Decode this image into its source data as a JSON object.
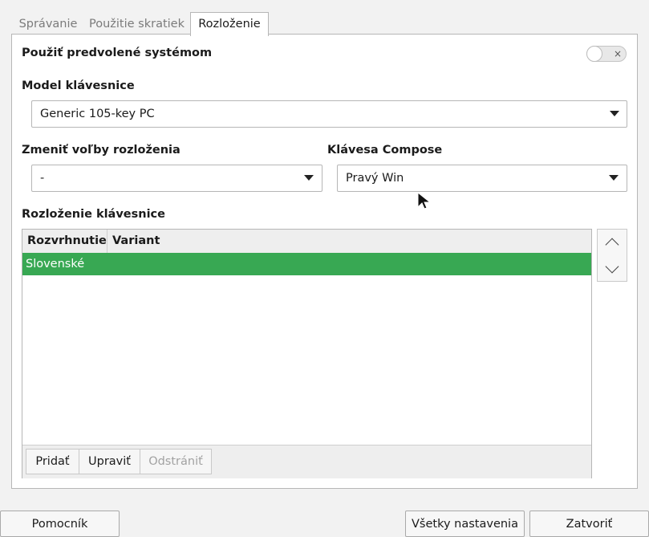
{
  "tabs": [
    {
      "label": "Správanie"
    },
    {
      "label": "Použitie skratiek"
    },
    {
      "label": "Rozloženie"
    }
  ],
  "use_system_default": {
    "label": "Použiť predvolené systémom",
    "toggle_on": false,
    "toggle_mark": "×"
  },
  "keyboard_model": {
    "label": "Model klávesnice",
    "value": "Generic 105-key PC"
  },
  "layout_options": {
    "label": "Zmeniť voľby rozloženia",
    "value": "-"
  },
  "compose_key": {
    "label": "Klávesa Compose",
    "value": "Pravý Win"
  },
  "layouts": {
    "label": "Rozloženie klávesnice",
    "columns": [
      "Rozvrhnutie",
      "Variant"
    ],
    "rows": [
      {
        "layout": "Slovenské",
        "variant": "",
        "selected": true
      }
    ],
    "add_label": "Pridať",
    "edit_label": "Upraviť",
    "remove_label": "Odstrániť"
  },
  "footer": {
    "help_label": "Pomocník",
    "all_settings_label": "Všetky nastavenia",
    "close_label": "Zatvoriť"
  },
  "colors": {
    "selection": "#38a853"
  }
}
